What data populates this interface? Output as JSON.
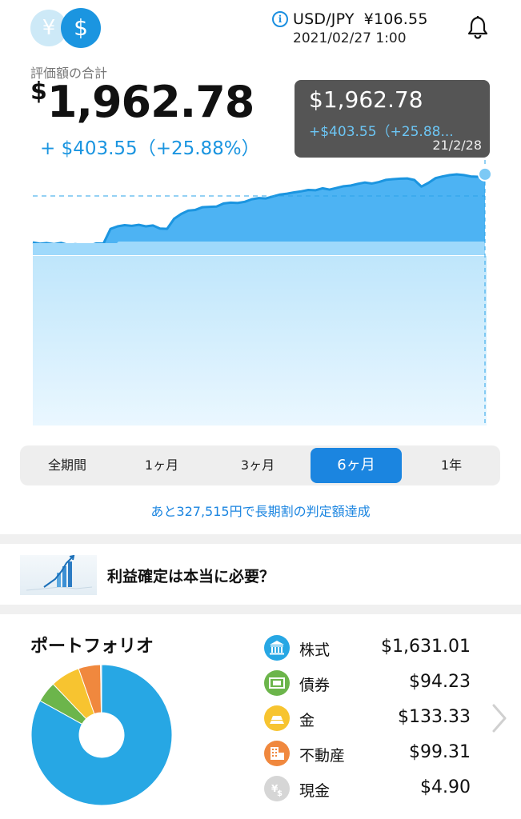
{
  "header": {
    "yen_symbol": "¥",
    "usd_symbol": "$",
    "fx_label": "USD/JPY",
    "fx_rate": "¥106.55",
    "fx_datetime": "2021/02/27 1:00"
  },
  "summary": {
    "label": "評価額の合計",
    "currency": "$",
    "total": "1,962.78",
    "change": "+ $403.55（+25.88%）"
  },
  "tooltip": {
    "value": "$1,962.78",
    "change": "+$403.55（+25.88...",
    "date": "21/2/28"
  },
  "chart_data": {
    "type": "area",
    "series": [
      {
        "values": [
          1560,
          1552,
          1556,
          1550,
          1557,
          1545,
          1550,
          1546,
          1541,
          1554,
          1553,
          1640,
          1655,
          1662,
          1658,
          1664,
          1655,
          1660,
          1642,
          1640,
          1700,
          1728,
          1748,
          1752,
          1768,
          1770,
          1772,
          1790,
          1795,
          1793,
          1800,
          1815,
          1822,
          1820,
          1832,
          1843,
          1848,
          1856,
          1862,
          1870,
          1868,
          1880,
          1872,
          1882,
          1892,
          1896,
          1906,
          1914,
          1908,
          1917,
          1930,
          1934,
          1937,
          1938,
          1929,
          1890,
          1912,
          1940,
          1950,
          1958,
          1962,
          1958,
          1950,
          1948,
          1962.78
        ]
      }
    ],
    "reference_line": 1559.23,
    "color": "#1b95e0"
  },
  "periods": {
    "active": "6ヶ月",
    "items": [
      "全期間",
      "1ヶ月",
      "3ヶ月",
      "6ヶ月",
      "1年"
    ]
  },
  "note": "あと327,515円で長期割の判定額達成",
  "article": {
    "title": "利益確定は本当に必要？"
  },
  "portfolio": {
    "title": "ポートフォリオ",
    "items": [
      {
        "icon": "bank-icon",
        "label": "株式",
        "value": "$1,631.01",
        "color": "#27a7e4",
        "amount": 1631.01
      },
      {
        "icon": "bond-icon",
        "label": "債券",
        "value": "$94.23",
        "color": "#6cb54b",
        "amount": 94.23
      },
      {
        "icon": "gold-icon",
        "label": "金",
        "value": "$133.33",
        "color": "#f7c430",
        "amount": 133.33
      },
      {
        "icon": "building-icon",
        "label": "不動産",
        "value": "$99.31",
        "color": "#f0883e",
        "amount": 99.31
      },
      {
        "icon": "cash-icon",
        "label": "現金",
        "value": "$4.90",
        "color": "#cfcfcf",
        "amount": 4.9
      }
    ]
  }
}
